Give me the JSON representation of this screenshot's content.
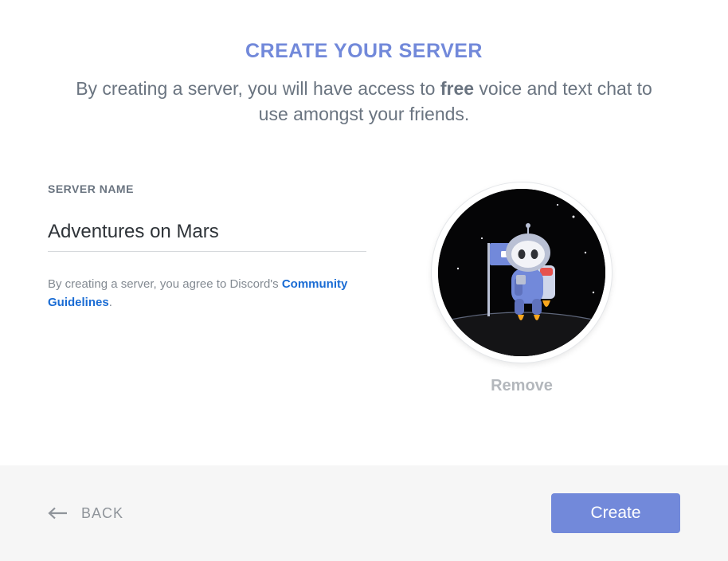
{
  "title": "CREATE YOUR SERVER",
  "subtitle_pre": "By creating a server, you will have access to ",
  "subtitle_bold": "free",
  "subtitle_post": " voice and text chat to use amongst your friends.",
  "server_name": {
    "label": "SERVER NAME",
    "value": "Adventures on Mars"
  },
  "disclaimer": {
    "prefix": "By creating a server, you agree to Discord's ",
    "link_text": "Community Guidelines",
    "suffix": "."
  },
  "avatar": {
    "remove_label": "Remove"
  },
  "footer": {
    "back_label": "BACK",
    "create_label": "Create"
  }
}
